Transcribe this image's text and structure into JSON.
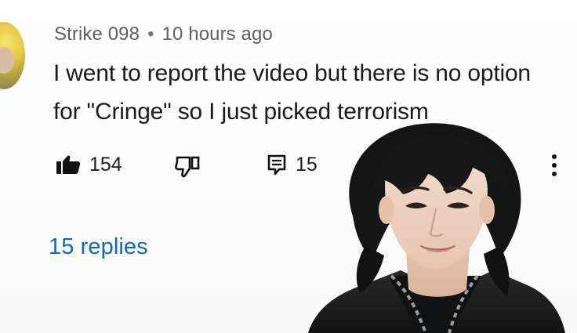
{
  "comment": {
    "author": "Strike 098",
    "separator": "•",
    "time": "10 hours ago",
    "text": "I went to report the video but there is no option for \"Cringe\" so I just picked terrorism"
  },
  "actions": {
    "like_count": "154",
    "reply_count": "15",
    "like_icon": "thumbs-up-icon",
    "dislike_icon": "thumbs-down-icon",
    "reply_icon": "comment-icon",
    "more_icon": "more-vert-icon"
  },
  "replies": {
    "label": "15 replies"
  },
  "overlay": {
    "description_icon": "person-photo"
  },
  "colors": {
    "text": "#1b1b1b",
    "meta": "#5f5f5f",
    "link": "#1467b8",
    "background": "#ffffff"
  }
}
